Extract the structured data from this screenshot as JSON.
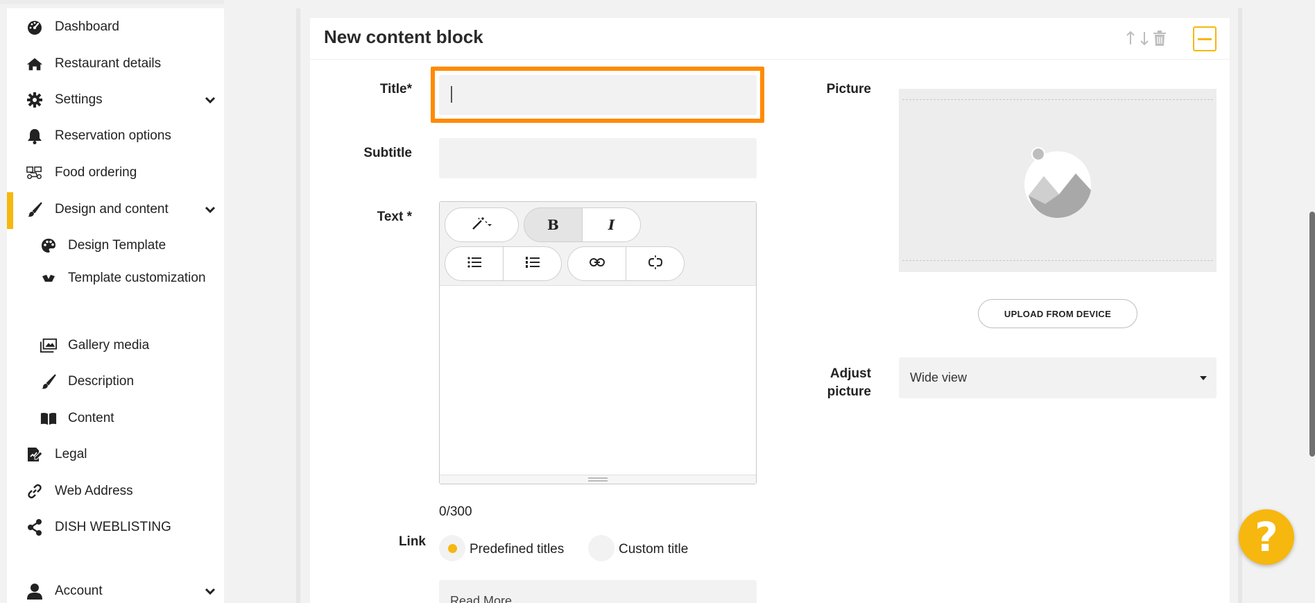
{
  "colors": {
    "accent": "#f6b70f",
    "highlight": "#ff8a00"
  },
  "sidebar": {
    "items": [
      {
        "label": "Dashboard",
        "icon": "dashboard-gauge-icon"
      },
      {
        "label": "Restaurant details",
        "icon": "home-icon"
      },
      {
        "label": "Settings",
        "icon": "gear-icon",
        "expandable": true
      },
      {
        "label": "Reservation options",
        "icon": "bell-icon"
      },
      {
        "label": "Food ordering",
        "icon": "delivery-scooter-icon"
      },
      {
        "label": "Design and content",
        "icon": "paintbrush-icon",
        "expandable": true,
        "active": true
      },
      {
        "label": "Design Template",
        "icon": "palette-icon",
        "sub": true
      },
      {
        "label": "Template customization",
        "icon": "template-icon",
        "sub": true
      },
      {
        "label": "Gallery media",
        "icon": "gallery-icon",
        "sub": true
      },
      {
        "label": "Description",
        "icon": "brush-icon",
        "sub": true
      },
      {
        "label": "Content",
        "icon": "book-icon",
        "sub": true
      },
      {
        "label": "Legal",
        "icon": "legal-document-icon"
      },
      {
        "label": "Web Address",
        "icon": "link-icon"
      },
      {
        "label": "DISH WEBLISTING",
        "icon": "share-icon"
      },
      {
        "label": "Account",
        "icon": "user-icon",
        "expandable": true
      }
    ]
  },
  "block": {
    "title": "New content block",
    "collapse_icon": "minus-icon"
  },
  "form": {
    "title_label": "Title*",
    "title_value": "",
    "subtitle_label": "Subtitle",
    "subtitle_value": "",
    "text_label": "Text *",
    "char_counter": "0/300",
    "link_label": "Link",
    "link_options": [
      "Predefined titles",
      "Custom title"
    ],
    "link_selected": "Predefined titles",
    "link_select_value": "Read More"
  },
  "editor_toolbar": {
    "magic_label": "▾",
    "bold_label": "B",
    "italic_label": "I"
  },
  "picture": {
    "label": "Picture",
    "upload_label": "UPLOAD FROM DEVICE",
    "adjust_label_line1": "Adjust",
    "adjust_label_line2": "picture",
    "adjust_value": "Wide view"
  },
  "help": {
    "label": "?"
  }
}
